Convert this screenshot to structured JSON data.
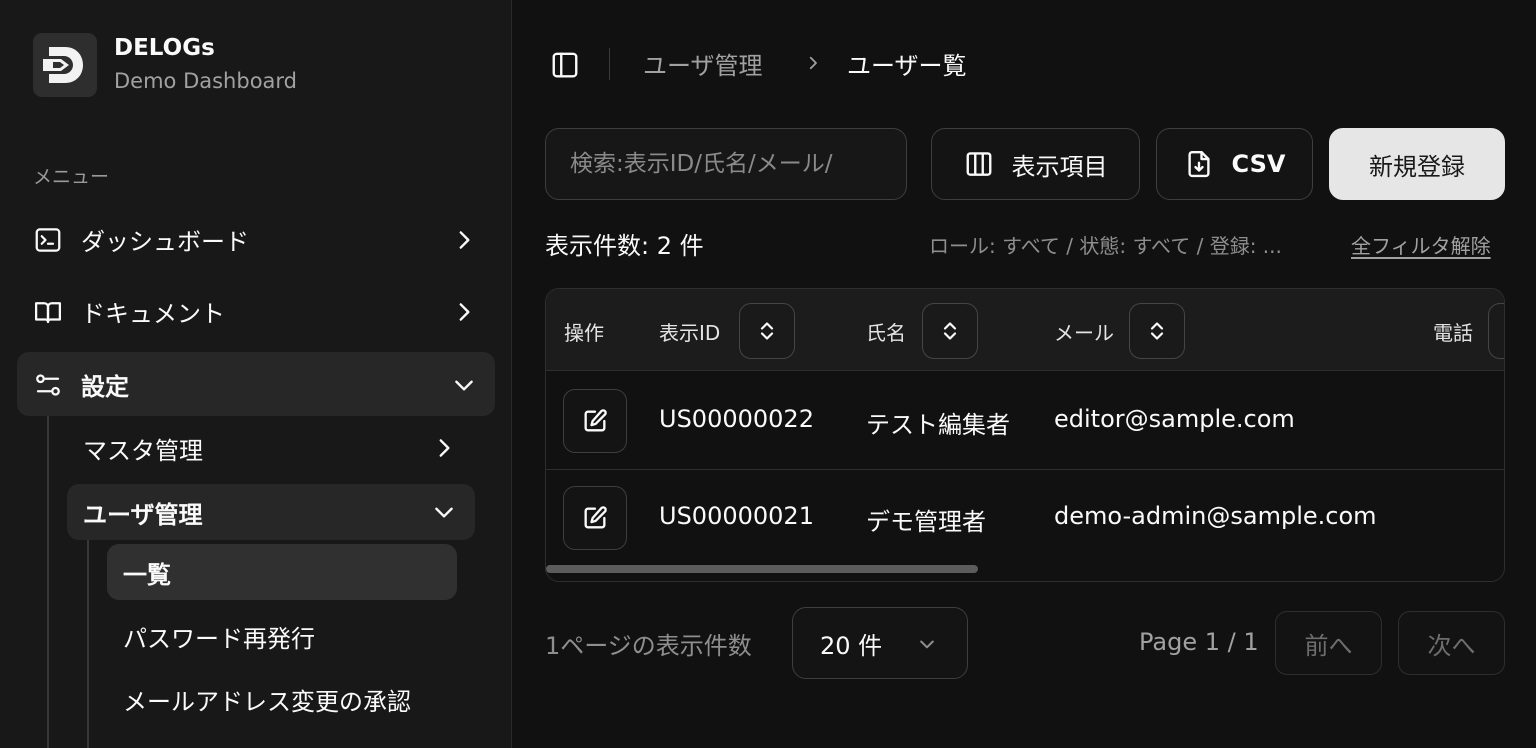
{
  "brand": {
    "name": "DELOGs",
    "subtitle": "Demo Dashboard",
    "logo_icon": "delogs-logo-icon"
  },
  "sidebar": {
    "section_label": "メニュー",
    "items": [
      {
        "label": "ダッシュボード",
        "icon": "terminal-icon",
        "expanded": false
      },
      {
        "label": "ドキュメント",
        "icon": "book-icon",
        "expanded": false
      },
      {
        "label": "設定",
        "icon": "settings-sliders-icon",
        "expanded": true,
        "children": [
          {
            "label": "マスタ管理",
            "expanded": false
          },
          {
            "label": "ユーザ管理",
            "expanded": true,
            "children": [
              {
                "label": "一覧",
                "current": true
              },
              {
                "label": "パスワード再発行"
              },
              {
                "label": "メールアドレス変更の承認"
              }
            ]
          }
        ]
      }
    ]
  },
  "breadcrumb": {
    "parent": "ユーザ管理",
    "current": "ユーザー覧"
  },
  "toolbar": {
    "search_placeholder": "検索:表示ID/氏名/メール/",
    "columns_label": "表示項目",
    "csv_label": "CSV",
    "new_label": "新規登録"
  },
  "summary": {
    "count_text": "表示件数: 2 件",
    "filters_text": "ロール: すべて / 状態: すべて / 登録: ...",
    "clear_filters": "全フィルタ解除"
  },
  "table": {
    "columns": [
      {
        "label": "操作",
        "sortable": false
      },
      {
        "label": "表示ID",
        "sortable": true
      },
      {
        "label": "氏名",
        "sortable": true
      },
      {
        "label": "メール",
        "sortable": true
      },
      {
        "label": "電話",
        "sortable": true
      }
    ],
    "rows": [
      {
        "display_id": "US00000022",
        "name": "テスト編集者",
        "email": "editor@sample.com"
      },
      {
        "display_id": "US00000021",
        "name": "デモ管理者",
        "email": "demo-admin@sample.com"
      }
    ]
  },
  "pagination": {
    "per_page_label": "1ページの表示件数",
    "per_page_value": "20 件",
    "page_info": "Page 1 / 1",
    "prev_label": "前へ",
    "next_label": "次へ",
    "prev_disabled": true,
    "next_disabled": true
  },
  "colors": {
    "background": "#111111",
    "sidebar": "#181818",
    "primary_button": "#e6e6e6",
    "border": "#3e3e3e"
  }
}
